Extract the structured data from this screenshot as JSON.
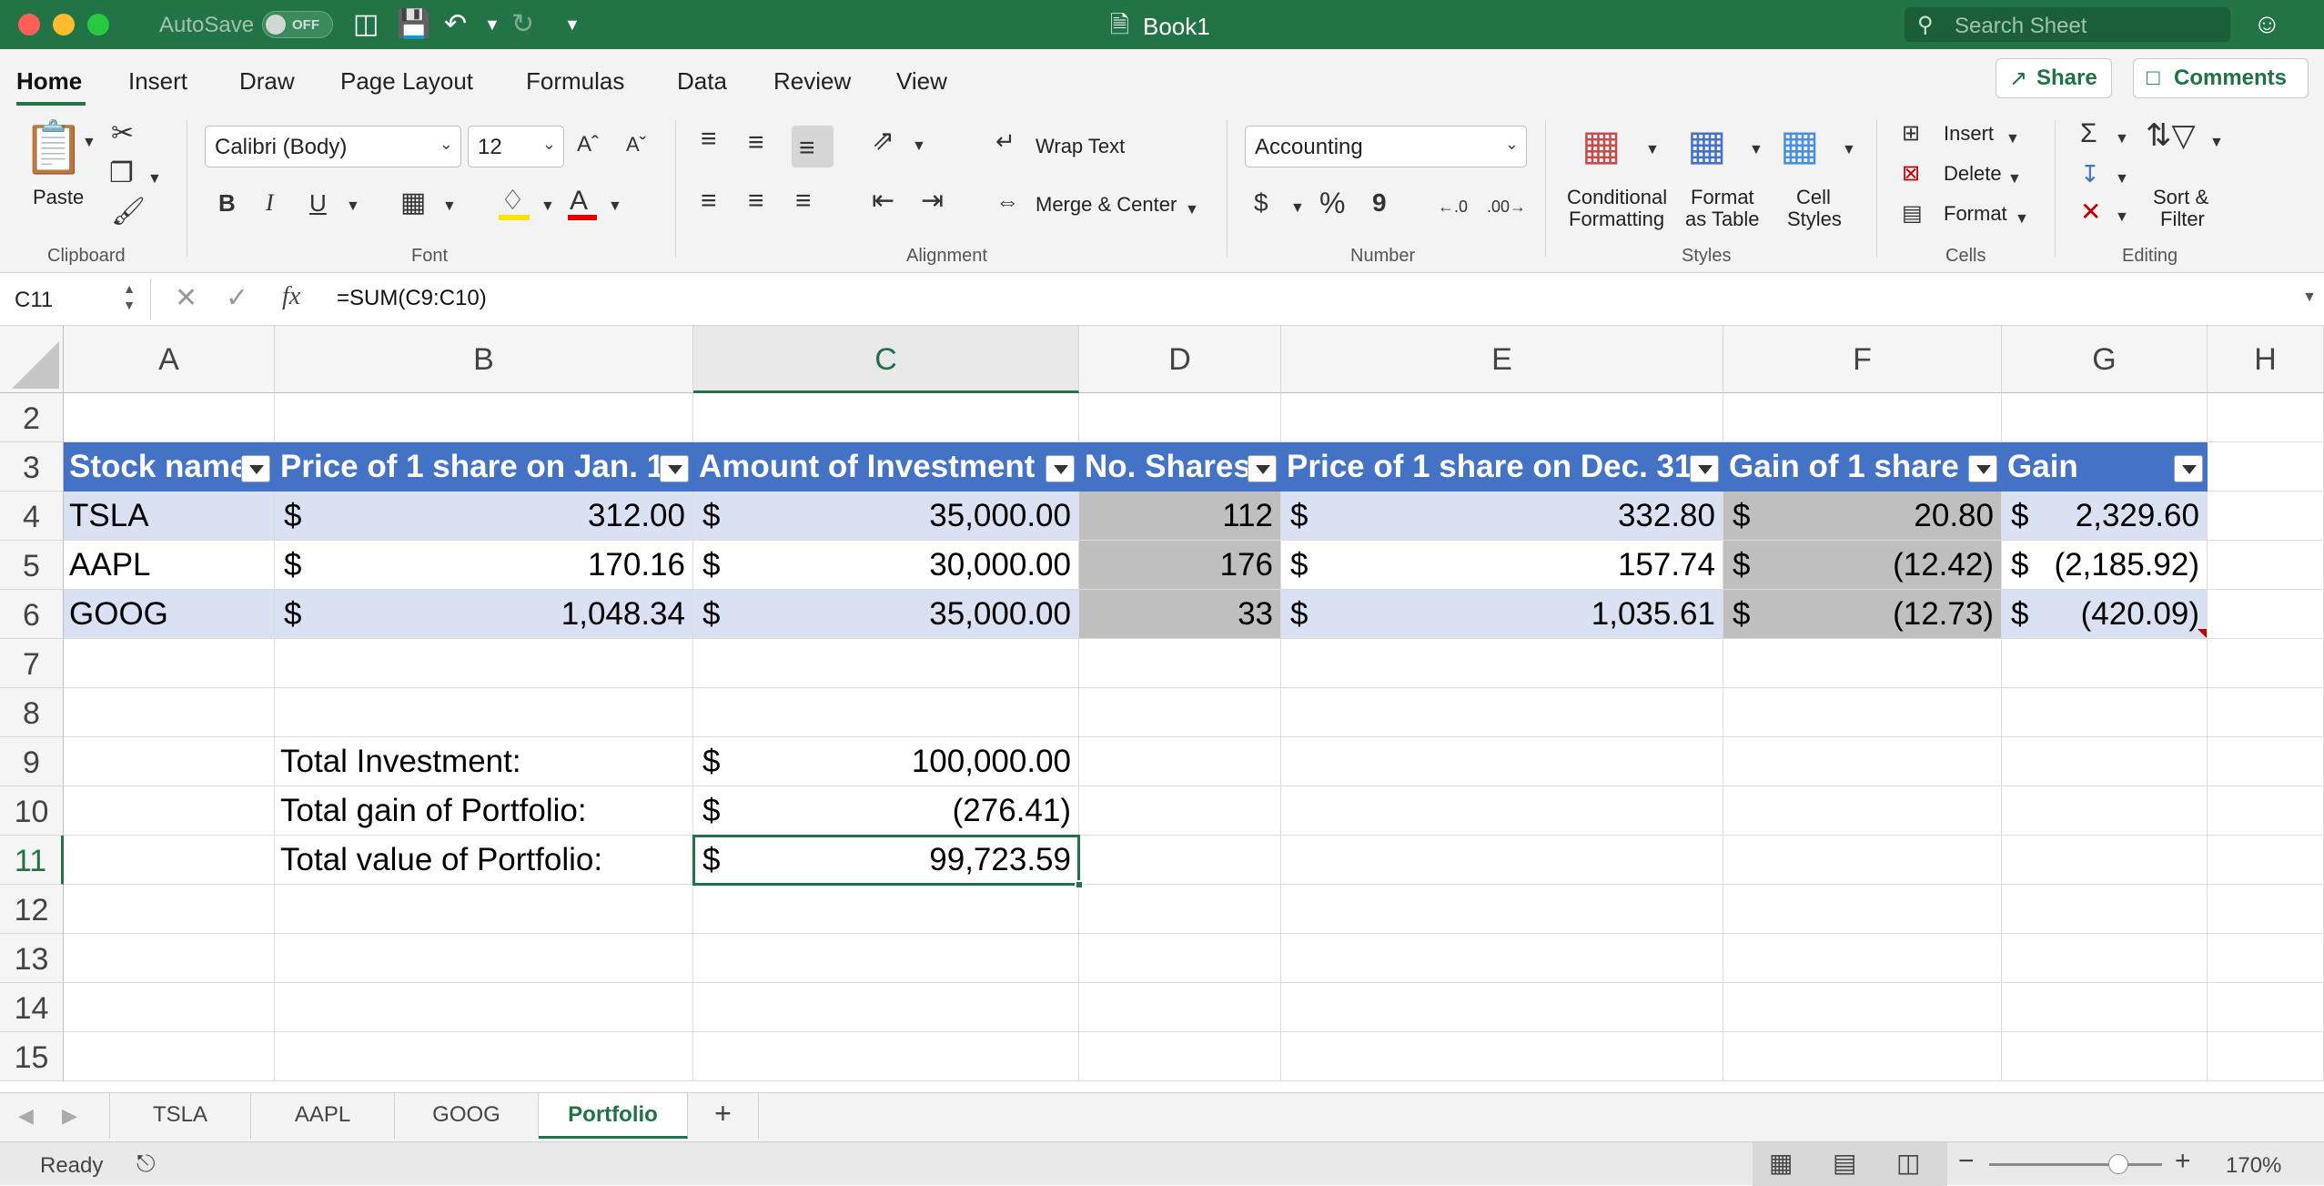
{
  "titlebar": {
    "autosave_label": "AutoSave",
    "autosave_state": "OFF",
    "doc_title": "Book1",
    "search_placeholder": "Search Sheet"
  },
  "menu": {
    "tabs": [
      "Home",
      "Insert",
      "Draw",
      "Page Layout",
      "Formulas",
      "Data",
      "Review",
      "View"
    ],
    "active": "Home",
    "share_label": "Share",
    "comments_label": "Comments"
  },
  "ribbon": {
    "clipboard": {
      "paste": "Paste",
      "group": "Clipboard"
    },
    "font": {
      "name": "Calibri (Body)",
      "size": "12",
      "bold": "B",
      "italic": "I",
      "underline": "U",
      "group": "Font"
    },
    "alignment": {
      "wrap": "Wrap Text",
      "merge": "Merge & Center",
      "group": "Alignment"
    },
    "number": {
      "format": "Accounting",
      "currency": "$",
      "percent": "%",
      "comma": "9",
      "group": "Number"
    },
    "styles": {
      "conditional_1": "Conditional",
      "conditional_2": "Formatting",
      "table_1": "Format",
      "table_2": "as Table",
      "cell_1": "Cell",
      "cell_2": "Styles",
      "group": "Styles"
    },
    "cells": {
      "insert": "Insert",
      "delete": "Delete",
      "format": "Format",
      "group": "Cells"
    },
    "editing": {
      "sort_1": "Sort &",
      "sort_2": "Filter",
      "group": "Editing"
    }
  },
  "formula_bar": {
    "name_box": "C11",
    "fx": "fx",
    "formula": "=SUM(C9:C10)"
  },
  "sheet": {
    "columns": [
      "A",
      "B",
      "C",
      "D",
      "E",
      "F",
      "G",
      "H"
    ],
    "selected_column": "C",
    "rows": [
      "2",
      "3",
      "4",
      "5",
      "6",
      "7",
      "8",
      "9",
      "10",
      "11",
      "12",
      "13",
      "14",
      "15"
    ],
    "selected_row": "11",
    "table_headers": [
      "Stock name",
      "Price of 1 share on Jan. 1",
      "Amount of Investment",
      "No. Shares",
      "Price of 1 share on Dec. 31",
      "Gain of 1 share",
      "Gain"
    ],
    "data_rows": [
      {
        "name": "TSLA",
        "price_jan": "312.00",
        "amount": "35,000.00",
        "shares": "112",
        "price_dec": "332.80",
        "gain_share": "20.80",
        "gain": "2,329.60"
      },
      {
        "name": "AAPL",
        "price_jan": "170.16",
        "amount": "30,000.00",
        "shares": "176",
        "price_dec": "157.74",
        "gain_share": "(12.42)",
        "gain": "(2,185.92)"
      },
      {
        "name": "GOOG",
        "price_jan": "1,048.34",
        "amount": "35,000.00",
        "shares": "33",
        "price_dec": "1,035.61",
        "gain_share": "(12.73)",
        "gain": "(420.09)"
      }
    ],
    "currency_symbol": "$",
    "summary": [
      {
        "label": "Total Investment:",
        "value": "100,000.00"
      },
      {
        "label": "Total gain of Portfolio:",
        "value": "(276.41)"
      },
      {
        "label": "Total value of Portfolio:",
        "value": "99,723.59"
      }
    ]
  },
  "sheet_tabs": {
    "tabs": [
      "TSLA",
      "AAPL",
      "GOOG",
      "Portfolio"
    ],
    "active": "Portfolio",
    "add": "+"
  },
  "status_bar": {
    "status": "Ready",
    "zoom": "170%",
    "zoom_level_percent": 170
  },
  "colors": {
    "excel_green": "#227447",
    "table_header": "#4472c4",
    "table_band": "#d9e1f2",
    "highlight_gray": "#bfbfbf"
  }
}
